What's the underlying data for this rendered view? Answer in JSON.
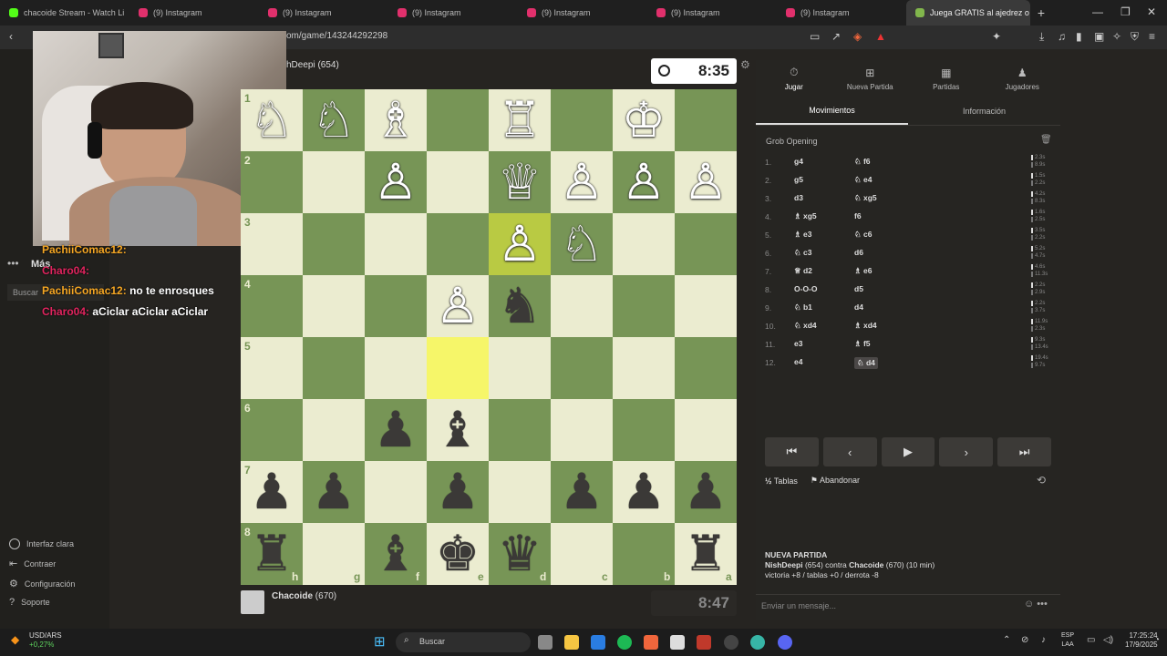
{
  "browser": {
    "tabs": [
      {
        "label": "chacoide Stream - Watch Li",
        "color": "#53fc18"
      },
      {
        "label": "(9) Instagram",
        "color": "#e1306c"
      },
      {
        "label": "(9) Instagram",
        "color": "#e1306c"
      },
      {
        "label": "(9) Instagram",
        "color": "#e1306c"
      },
      {
        "label": "(9) Instagram",
        "color": "#e1306c"
      },
      {
        "label": "(9) Instagram",
        "color": "#e1306c"
      },
      {
        "label": "(9) Instagram",
        "color": "#e1306c"
      },
      {
        "label": "Juega GRATIS al ajedrez o",
        "color": "#81b64c"
      }
    ],
    "url": "om/game/143244292298"
  },
  "leftnav": {
    "more_label": "Más",
    "search_placeholder": "Buscar",
    "bottom": [
      "Interfaz clara",
      "Contraer",
      "Configuración",
      "Soporte"
    ]
  },
  "chat": [
    {
      "user": "PachiiComac12:",
      "message": ""
    },
    {
      "user": "Charo04:",
      "message": ""
    },
    {
      "user": "PachiiComac12:",
      "message": "no te enrosques"
    },
    {
      "user": "Charo04:",
      "message": "aCiclar aCiclar aCiclar"
    }
  ],
  "game": {
    "top_player": "NishDeepi (654)",
    "top_player_visible": "hDeepi (654)",
    "top_clock": "8:35",
    "bottom_player": "Chacoide",
    "bottom_rating": "(670)",
    "bottom_clock": "8:47",
    "ranks": [
      "1",
      "2",
      "3",
      "4",
      "5",
      "6",
      "7",
      "8"
    ],
    "files": [
      "h",
      "g",
      "f",
      "e",
      "d",
      "c",
      "b",
      "a"
    ],
    "highlight": {
      "from": [
        2,
        4
      ],
      "to": [
        4,
        3
      ]
    },
    "pieces": [
      {
        "r": 0,
        "c": 0,
        "p": "♘",
        "s": "w"
      },
      {
        "r": 0,
        "c": 1,
        "p": "♘",
        "s": "w"
      },
      {
        "r": 0,
        "c": 2,
        "p": "♗",
        "s": "w"
      },
      {
        "r": 0,
        "c": 4,
        "p": "♖",
        "s": "w"
      },
      {
        "r": 0,
        "c": 6,
        "p": "♔",
        "s": "w"
      },
      {
        "r": 1,
        "c": 2,
        "p": "♙",
        "s": "w"
      },
      {
        "r": 1,
        "c": 4,
        "p": "♕",
        "s": "w"
      },
      {
        "r": 1,
        "c": 5,
        "p": "♙",
        "s": "w"
      },
      {
        "r": 1,
        "c": 6,
        "p": "♙",
        "s": "w"
      },
      {
        "r": 1,
        "c": 7,
        "p": "♙",
        "s": "w"
      },
      {
        "r": 2,
        "c": 4,
        "p": "♙",
        "s": "w"
      },
      {
        "r": 2,
        "c": 5,
        "p": "♘",
        "s": "w"
      },
      {
        "r": 3,
        "c": 3,
        "p": "♙",
        "s": "w"
      },
      {
        "r": 3,
        "c": 4,
        "p": "♞",
        "s": "b"
      },
      {
        "r": 5,
        "c": 2,
        "p": "♟",
        "s": "b"
      },
      {
        "r": 5,
        "c": 3,
        "p": "♝",
        "s": "b"
      },
      {
        "r": 6,
        "c": 0,
        "p": "♟",
        "s": "b"
      },
      {
        "r": 6,
        "c": 1,
        "p": "♟",
        "s": "b"
      },
      {
        "r": 6,
        "c": 3,
        "p": "♟",
        "s": "b"
      },
      {
        "r": 6,
        "c": 5,
        "p": "♟",
        "s": "b"
      },
      {
        "r": 6,
        "c": 6,
        "p": "♟",
        "s": "b"
      },
      {
        "r": 6,
        "c": 7,
        "p": "♟",
        "s": "b"
      },
      {
        "r": 7,
        "c": 0,
        "p": "♜",
        "s": "b"
      },
      {
        "r": 7,
        "c": 2,
        "p": "♝",
        "s": "b"
      },
      {
        "r": 7,
        "c": 3,
        "p": "♚",
        "s": "b"
      },
      {
        "r": 7,
        "c": 4,
        "p": "♛",
        "s": "b"
      },
      {
        "r": 7,
        "c": 7,
        "p": "♜",
        "s": "b"
      }
    ]
  },
  "panel": {
    "tabs": [
      {
        "label": "Jugar",
        "icon": "⏱"
      },
      {
        "label": "Nueva Partida",
        "icon": "⊞"
      },
      {
        "label": "Partidas",
        "icon": "▦"
      },
      {
        "label": "Jugadores",
        "icon": "♟"
      }
    ],
    "subtabs": [
      "Movimientos",
      "Información"
    ],
    "opening": "Grob Opening",
    "moves": [
      {
        "n": "1.",
        "w": "g4",
        "b": "♘ f6",
        "tw": "2.3s",
        "tb": "8.9s"
      },
      {
        "n": "2.",
        "w": "g5",
        "b": "♘ e4",
        "tw": "1.5s",
        "tb": "2.2s"
      },
      {
        "n": "3.",
        "w": "d3",
        "b": "♘ xg5",
        "tw": "4.2s",
        "tb": "8.3s"
      },
      {
        "n": "4.",
        "w": "♗ xg5",
        "b": "f6",
        "tw": "1.6s",
        "tb": "2.5s"
      },
      {
        "n": "5.",
        "w": "♗ e3",
        "b": "♘ c6",
        "tw": "3.5s",
        "tb": "2.2s"
      },
      {
        "n": "6.",
        "w": "♘ c3",
        "b": "d6",
        "tw": "5.2s",
        "tb": "4.7s"
      },
      {
        "n": "7.",
        "w": "♕ d2",
        "b": "♗ e6",
        "tw": "4.6s",
        "tb": "11.3s"
      },
      {
        "n": "8.",
        "w": "O-O-O",
        "b": "d5",
        "tw": "2.2s",
        "tb": "2.9s"
      },
      {
        "n": "9.",
        "w": "♘ b1",
        "b": "d4",
        "tw": "2.2s",
        "tb": "3.7s"
      },
      {
        "n": "10.",
        "w": "♘ xd4",
        "b": "♗ xd4",
        "tw": "11.9s",
        "tb": "2.3s"
      },
      {
        "n": "11.",
        "w": "e3",
        "b": "♗ f5",
        "tw": "9.3s",
        "tb": "13.4s"
      },
      {
        "n": "12.",
        "w": "e4",
        "b": "♘ d4",
        "tw": "19.4s",
        "tb": "9.7s"
      }
    ],
    "nav_buttons": [
      "⏮",
      "‹",
      "▶",
      "›",
      "⏭"
    ],
    "draw_label": "Tablas",
    "resign_label": "Abandonar",
    "newgame_title": "NUEVA PARTIDA",
    "newgame_players_a": "NishDeepi",
    "newgame_players_b": " (654) contra ",
    "newgame_players_c": "Chacoide",
    "newgame_players_d": " (670) (10 min)",
    "newgame_stats": "victoria +8 / tablas +0 / derrota -8",
    "chat_placeholder": "Enviar un mensaje..."
  },
  "taskbar": {
    "ticker_name": "USD/ARS",
    "ticker_change": "+0,27%",
    "search": "Buscar",
    "lang_1": "ESP",
    "lang_2": "LAA",
    "time": "17:25:24",
    "date": "17/9/2025"
  }
}
